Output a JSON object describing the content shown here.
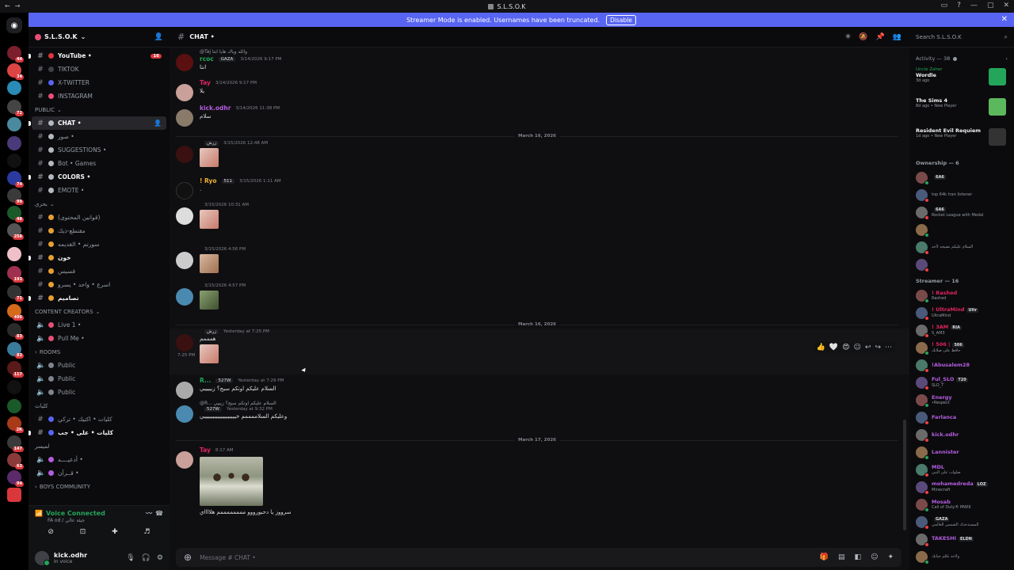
{
  "window": {
    "title": "S.L.S.O.K"
  },
  "banner": {
    "text": "Streamer Mode is enabled. Usernames have been truncated.",
    "disable_label": "Disable"
  },
  "guild": {
    "name": "S.L.S.O.K",
    "channels_top": [
      {
        "name": "YouTube •",
        "bold": true,
        "count": "16",
        "dot": "#da373c",
        "icon": "play-icon"
      },
      {
        "name": "TIKTOK",
        "bold": false,
        "dot": "#3f4147"
      },
      {
        "name": "X-TWITTER",
        "bold": false,
        "dot": "#5865f2"
      },
      {
        "name": "INSTAGRAM",
        "bold": false,
        "dot": "#e94e77"
      }
    ],
    "public_category": "PUBLIC",
    "channels_public": [
      {
        "name": "CHAT •",
        "active": true
      },
      {
        "name": "صور •",
        "bold": false
      },
      {
        "name": "SUGGESTIONS •",
        "bold": false
      },
      {
        "name": "Bot • Games",
        "bold": false
      },
      {
        "name": "COLORS •",
        "bold": true
      },
      {
        "name": "EMOTE •",
        "bold": false
      }
    ],
    "mod_category": "بحري",
    "channels_mod": [
      {
        "name": "(قوانين المحتوى)"
      },
      {
        "name": "مقتطع-ذيك"
      },
      {
        "name": "سورتم • القديمه"
      },
      {
        "name": "خون",
        "bold": true
      },
      {
        "name": "قسيس"
      },
      {
        "name": "اسرع • واحد • يسرو"
      },
      {
        "name": "تصاميم",
        "bold": true
      }
    ],
    "creators_category": "CONTENT CREATORS",
    "channels_creators": [
      {
        "name": "Live 1 •"
      },
      {
        "name": "Pull Me •"
      }
    ],
    "rooms_category": "ROOMS",
    "channels_rooms": [
      {
        "name": "Public"
      },
      {
        "name": "Public"
      },
      {
        "name": "Public"
      }
    ],
    "k_category": "كليات",
    "channels_k": [
      {
        "name": "كليات • اكتيك • تركي"
      },
      {
        "name": "كليات • على • جب",
        "bold": true
      }
    ],
    "l_category": "لميسر",
    "channels_l": [
      {
        "name": "أدعيــــه •"
      },
      {
        "name": "قــرآن •"
      }
    ],
    "boys_category": "Boys Community"
  },
  "voice": {
    "status": "Voice Connected",
    "sub": "FA od / جيئة عالي"
  },
  "user": {
    "name": "kick.odhr",
    "status": "In voice"
  },
  "chat": {
    "channel": "CHAT •",
    "composer_placeholder": "Message # CHAT •",
    "messages": [
      {
        "user": "rcoc",
        "time": "3/14/2026 9:17 PM",
        "tag": "GAZA",
        "text": "انتا",
        "reply": "@Taj والله وياك هايا انتا"
      },
      {
        "user": "Tay",
        "time": "3/14/2026 9:17 PM",
        "text": "يلا"
      },
      {
        "user": "kick.odhr",
        "time": "3/14/2026 11:38 PM",
        "text": "سلام"
      },
      {
        "user": "",
        "time": "3/15/2026 12:48 AM",
        "tag": "زرش",
        "text": ""
      },
      {
        "user": "! Ryo",
        "time": "3/15/2026 1:11 AM",
        "tag": "511",
        "text": "."
      },
      {
        "user": "",
        "time": "3/15/2026 10:31 AM",
        "text": ""
      },
      {
        "user": "",
        "time": "3/15/2026 4:56 PM",
        "text": ""
      },
      {
        "user": "",
        "time": "3/15/2026 4:57 PM",
        "text": ""
      },
      {
        "user": "",
        "time": "Yesterday at 7:25 PM",
        "tag": "زرش",
        "text": "همممم",
        "side_time": "7:25 PM"
      },
      {
        "user": "R...",
        "time": "Yesterday at 7:29 PM",
        "tag": "527W",
        "text": "السلام عليكم اوتكم سيج؟ زيييييي"
      },
      {
        "user": "",
        "time": "Yesterday at 9:32 PM",
        "tag": "527W",
        "text": "وعليكم السلاممممم خيييييييييييييييييييي",
        "reply": "@R... السلام عليكم اوتكم سيج؟ زيييي"
      },
      {
        "user": "Tay",
        "time": "8:17 AM",
        "text": "سرووز يا دحبورووو ممممممممم هلااااي"
      }
    ],
    "separators": [
      "March 16, 2026",
      "March 16, 2026",
      "March 17, 2026"
    ]
  },
  "search": {
    "placeholder": "Search S.L.S.O.K"
  },
  "members": {
    "activity_label": "Activity — 38",
    "activities": [
      {
        "user": "Uncle Zaher",
        "title": "Wordle",
        "sub": "3d ago",
        "color": "#23a55a"
      },
      {
        "user": "",
        "title": "The Sims 4",
        "sub": "8d ago • New Player",
        "color": "#5cb85c"
      },
      {
        "user": "",
        "title": "Resident Evil Requiem",
        "sub": "1d ago • New Player",
        "color": "#333"
      }
    ],
    "ownership_label": "Ownership — 6",
    "ownership": [
      {
        "name": "",
        "sub": "",
        "tag": "6A6",
        "color": "#e0245e"
      },
      {
        "name": "",
        "sub": "top 64k tran listener",
        "color": "#949ba4"
      },
      {
        "name": "",
        "sub": "Rocket League with Medal",
        "tag": "6A6",
        "color": "#949ba4"
      },
      {
        "name": "",
        "sub": "",
        "color": "#949ba4"
      },
      {
        "name": "",
        "sub": "السلام عليكم نصيحه لأحد",
        "color": "#949ba4"
      },
      {
        "name": "",
        "sub": "",
        "color": "#949ba4"
      }
    ],
    "streamer_label": "Streamer — 16",
    "streamers": [
      {
        "name": "! Rashed",
        "sub": "Rashed",
        "color": "#e0245e"
      },
      {
        "name": "! UltraMind",
        "sub": "UltraMind",
        "tag": "Ultr",
        "color": "#e0245e"
      },
      {
        "name": "! 3AM",
        "sub": "S_AM3",
        "tag": "RIA",
        "color": "#e0245e"
      },
      {
        "name": "! 506 |",
        "sub": "حافظ على صلاتك",
        "tag": "506",
        "color": "#e0245e"
      },
      {
        "name": "!Abusalem28",
        "sub": "",
        "color": "#b45ee0"
      },
      {
        "name": "Ful_SLO",
        "sub": "SLO_T",
        "tag": "T20",
        "color": "#b45ee0"
      },
      {
        "name": "Energy",
        "sub": "•Respect",
        "color": "#b45ee0"
      },
      {
        "name": "Farlanca",
        "sub": "",
        "color": "#b45ee0"
      },
      {
        "name": "kick.odhr",
        "sub": "",
        "color": "#b45ee0"
      },
      {
        "name": "Lannister",
        "sub": "",
        "color": "#b45ee0"
      },
      {
        "name": "MDL",
        "sub": "صلوات على النبي",
        "color": "#b45ee0"
      },
      {
        "name": "mohamedreda",
        "sub": "Minecraft",
        "tag": "LOZ",
        "color": "#b45ee0"
      },
      {
        "name": "Mosab",
        "sub": "Call of Duty® MWIII",
        "color": "#b45ee0"
      },
      {
        "name": "",
        "sub": "المستدحدك الشمس العالمي",
        "tag": "GAZA",
        "color": "#b45ee0"
      },
      {
        "name": "TAKESHI",
        "sub": "",
        "tag": "ELDN",
        "color": "#b45ee0"
      },
      {
        "name": "",
        "sub": "ولاحد تكلم جيابك",
        "color": "#b45ee0"
      }
    ]
  }
}
